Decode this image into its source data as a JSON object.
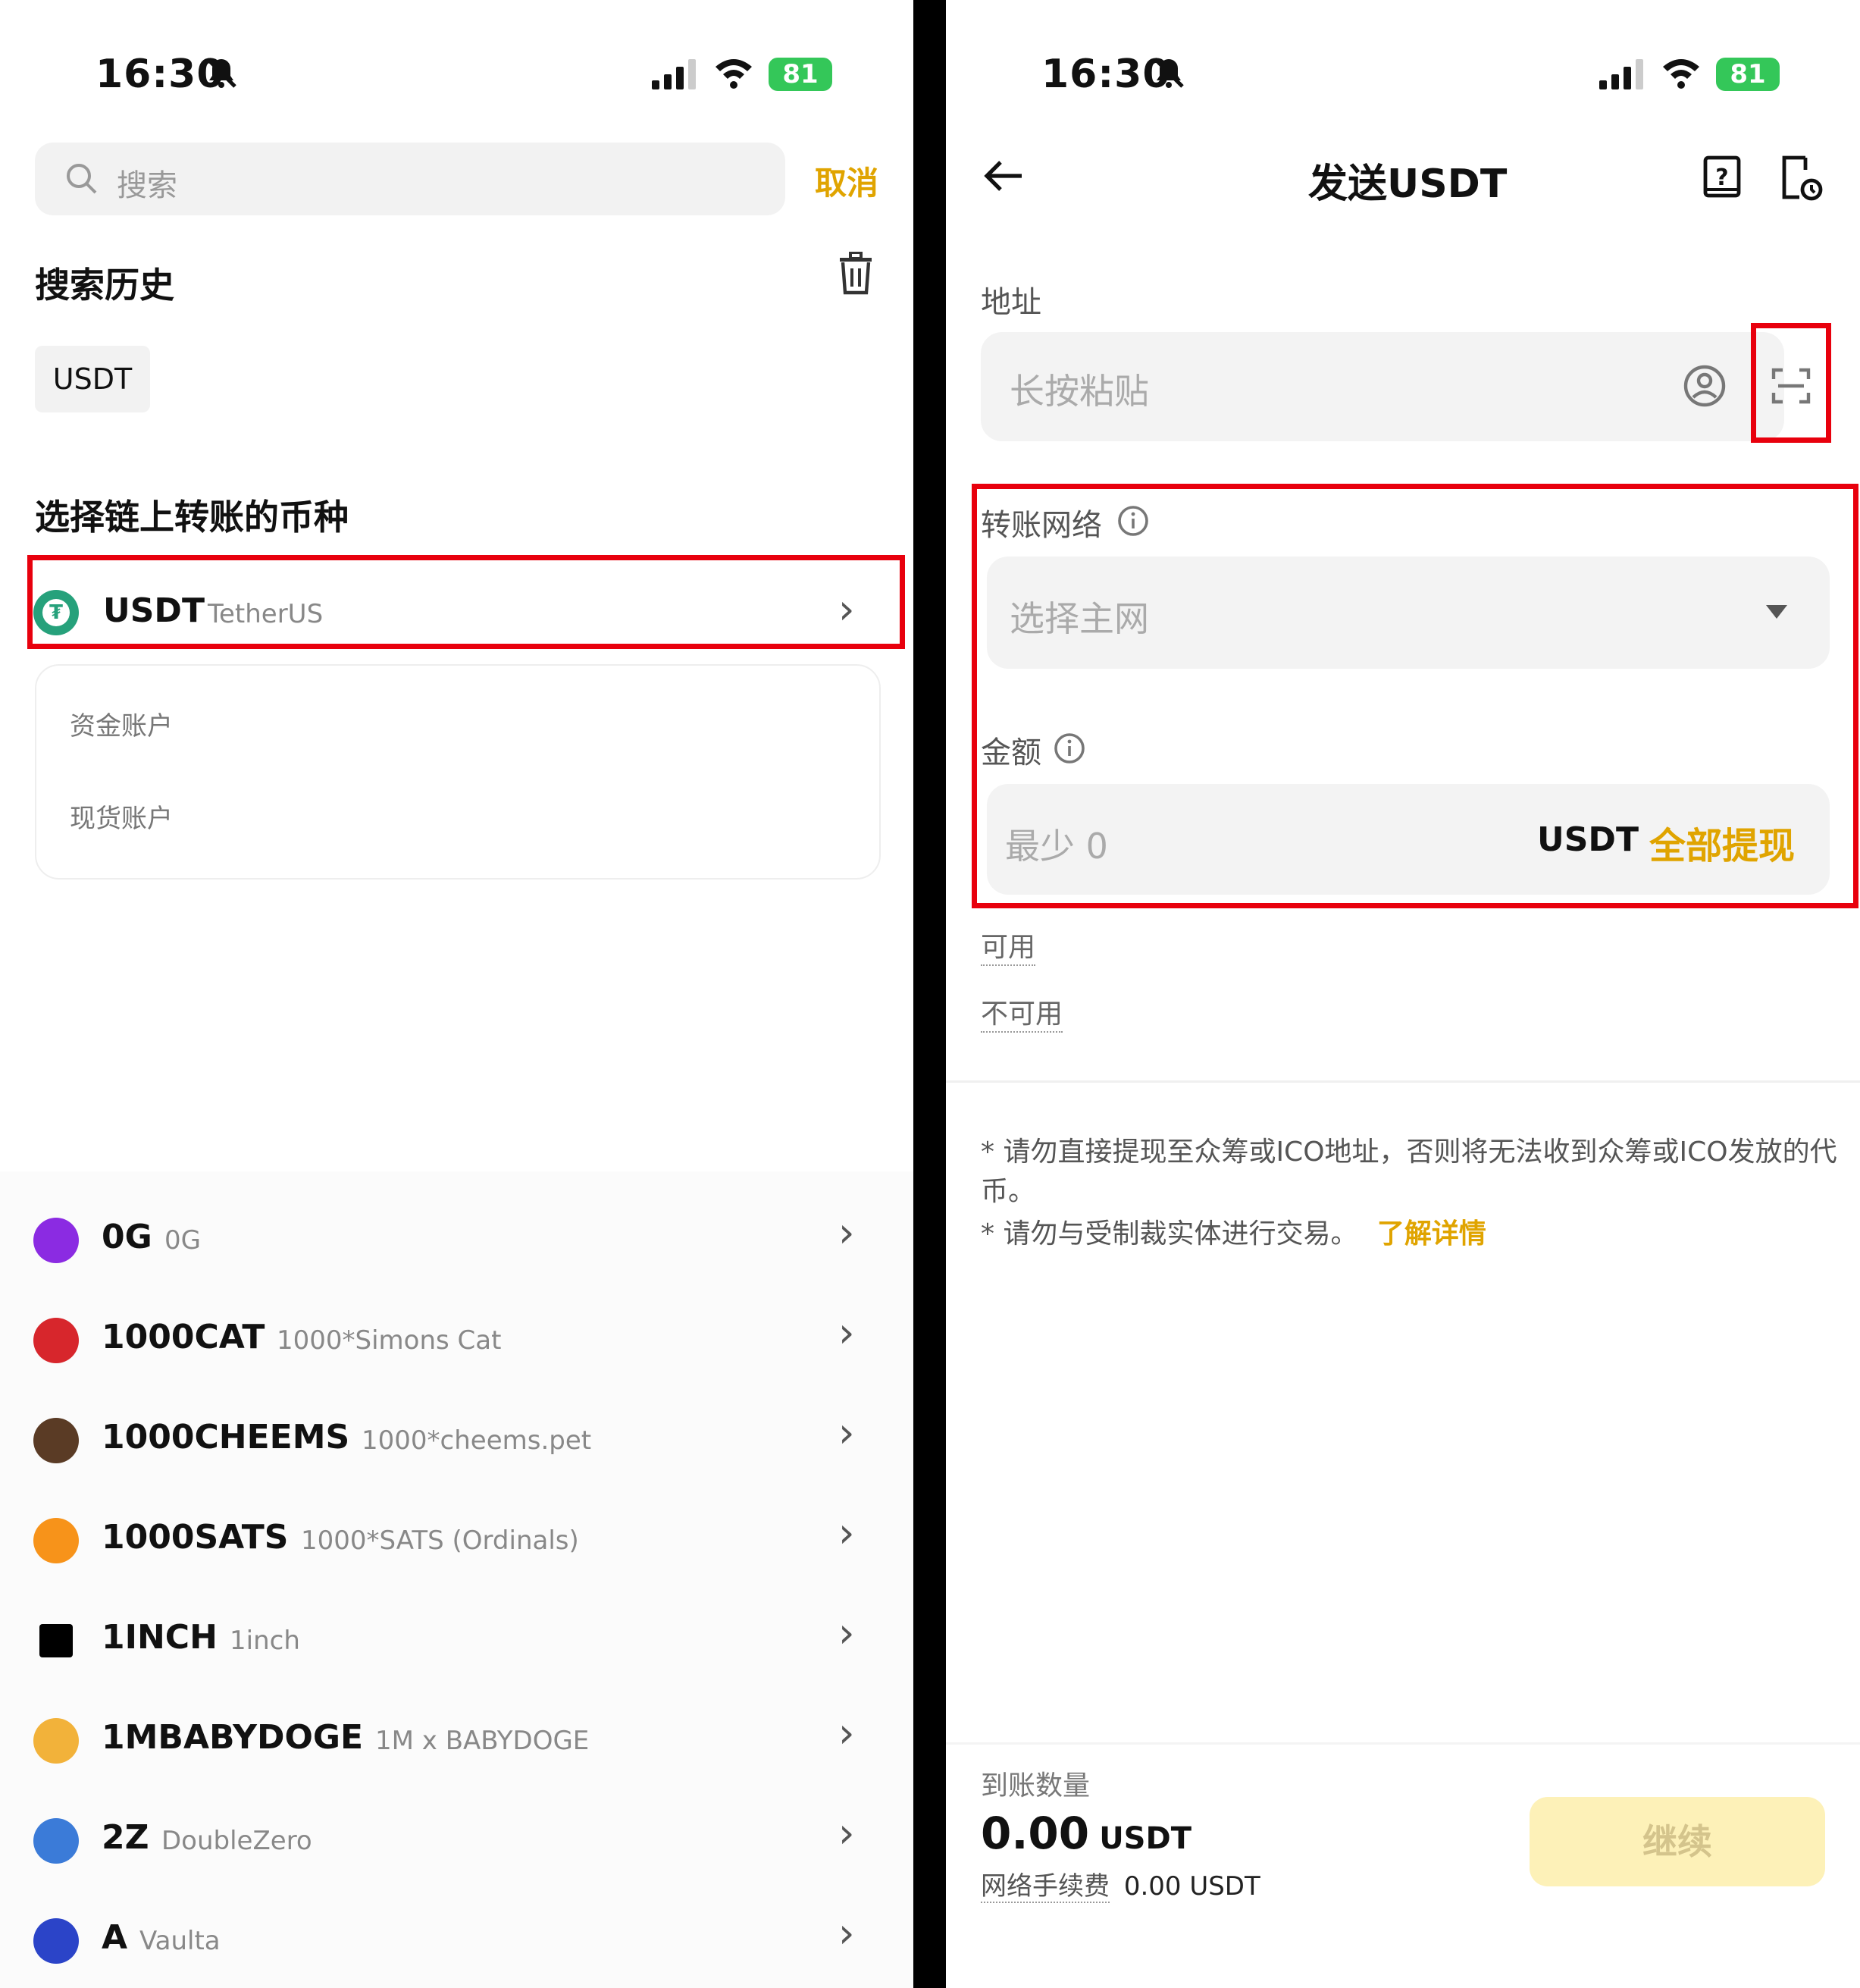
{
  "status_bar": {
    "time": "16:30",
    "battery": "81"
  },
  "left": {
    "search_placeholder": "搜索",
    "cancel_label": "取消",
    "history_title": "搜索历史",
    "history_chip": "USDT",
    "choose_title": "选择链上转账的币种",
    "selected_coin": {
      "symbol": "USDT",
      "name": "TetherUS"
    },
    "accounts": [
      "资金账户",
      "现货账户"
    ],
    "coins": [
      {
        "symbol": "0G",
        "name": "0G",
        "color": "#8b2be2"
      },
      {
        "symbol": "1000CAT",
        "name": "1000*Simons Cat",
        "color": "#d7262c"
      },
      {
        "symbol": "1000CHEEMS",
        "name": "1000*cheems.pet",
        "color": "#5a3b25"
      },
      {
        "symbol": "1000SATS",
        "name": "1000*SATS (Ordinals)",
        "color": "#f7931a"
      },
      {
        "symbol": "1INCH",
        "name": "1inch",
        "color": "#000000"
      },
      {
        "symbol": "1MBABYDOGE",
        "name": "1M x BABYDOGE",
        "color": "#f2b23a"
      },
      {
        "symbol": "2Z",
        "name": "DoubleZero",
        "color": "#3b7bd8"
      },
      {
        "symbol": "A",
        "name": "Vaulta",
        "color": "#2b44c8"
      }
    ]
  },
  "right": {
    "title": "发送USDT",
    "address_label": "地址",
    "address_placeholder": "长按粘贴",
    "network_label": "转账网络",
    "network_placeholder": "选择主网",
    "amount_label": "金额",
    "amount_placeholder": "最少 0",
    "amount_unit": "USDT",
    "withdraw_all": "全部提现",
    "available_label": "可用",
    "unavailable_label": "不可用",
    "notice_1": "* 请勿直接提现至众筹或ICO地址，否则将无法收到众筹或ICO发放的代币。",
    "notice_2": "* 请勿与受制裁实体进行交易。",
    "learn_more": "了解详情",
    "receive_label": "到账数量",
    "receive_amount": "0.00",
    "receive_unit": "USDT",
    "fee_label": "网络手续费",
    "fee_value": "0.00 USDT",
    "continue_label": "继续"
  },
  "colors": {
    "accent": "#e0a400",
    "highlight": "#e8000d",
    "battery": "#34c759",
    "tether": "#26a17b"
  }
}
